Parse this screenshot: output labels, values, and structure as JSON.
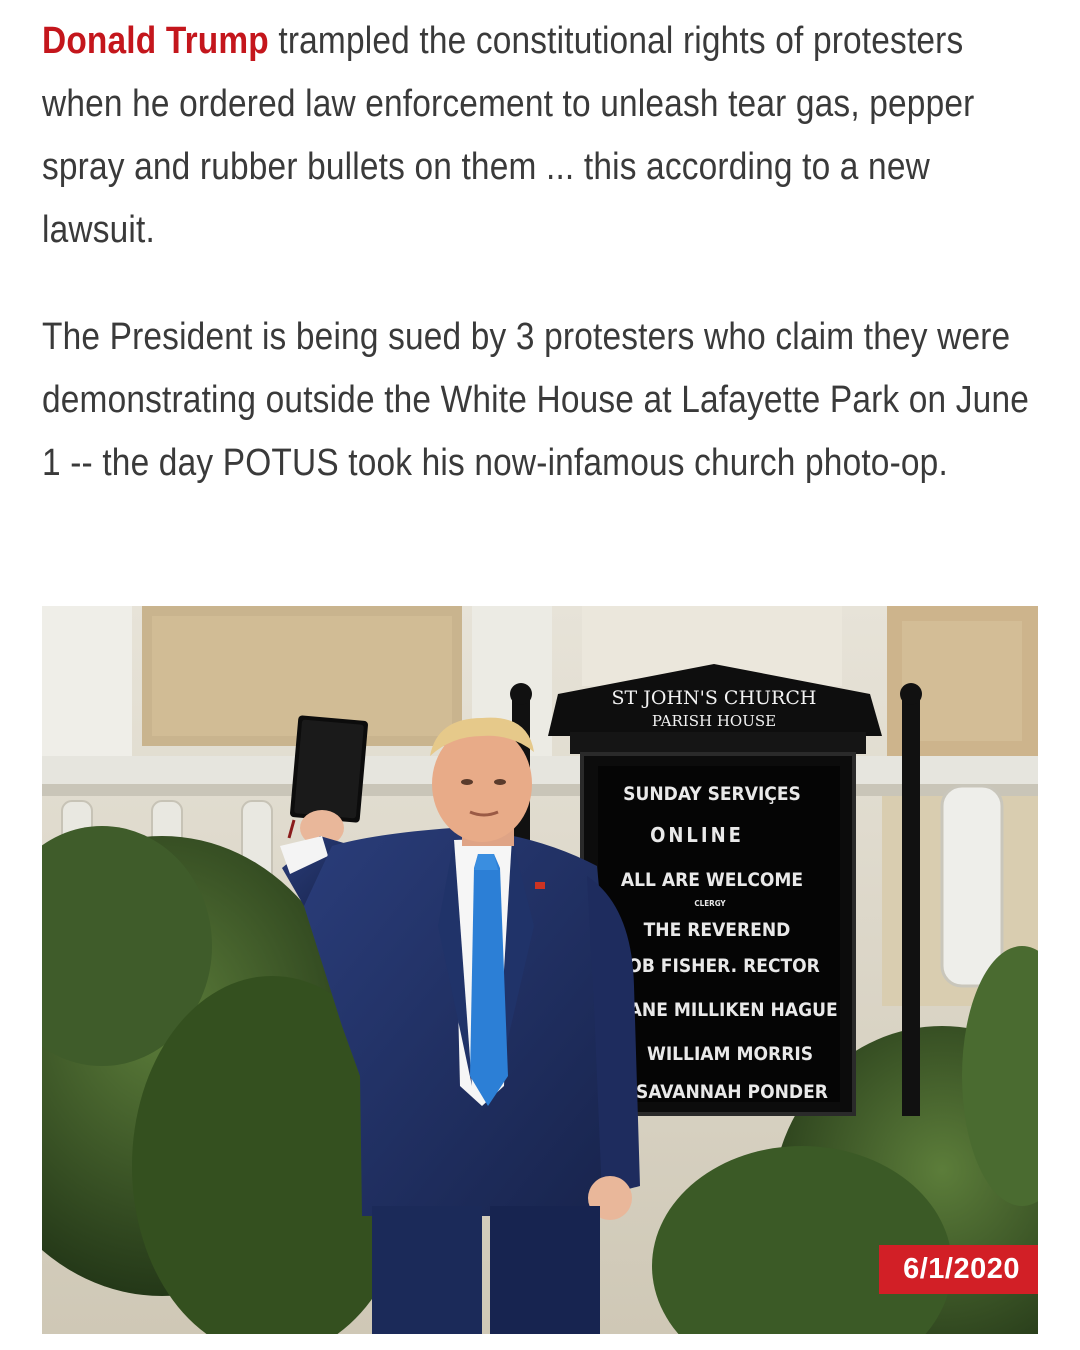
{
  "article": {
    "paragraph1": {
      "link_text": "Donald Trump",
      "text": " trampled the constitutional rights of protesters when he ordered law enforcement to unleash tear gas, pepper spray and rubber bullets on them ... this according to a new lawsuit."
    },
    "paragraph2": {
      "text": "The President is being sued by 3 protesters who claim they were demonstrating outside the White House at Lafayette Park on June 1 -- the day POTUS took his now-infamous church photo-op."
    }
  },
  "photo": {
    "date_label": "6/1/2020",
    "sign": {
      "title_line1": "ST JOHN'S CHURCH",
      "title_line2": "PARISH HOUSE",
      "lines": [
        "SUNDAY SERVIÇES",
        "ONLINE",
        "ALL ARE WELCOME",
        "CLERGY",
        "THE REVEREND",
        "ROB FISHER. RECTOR",
        "JANE MILLIKEN HAGUE",
        "WILLIAM MORRIS",
        "SAVANNAH PONDER"
      ]
    }
  },
  "colors": {
    "link": "#c4161c",
    "body_text": "#3a3a3a",
    "badge_bg": "#d21f26",
    "badge_text": "#ffffff"
  }
}
